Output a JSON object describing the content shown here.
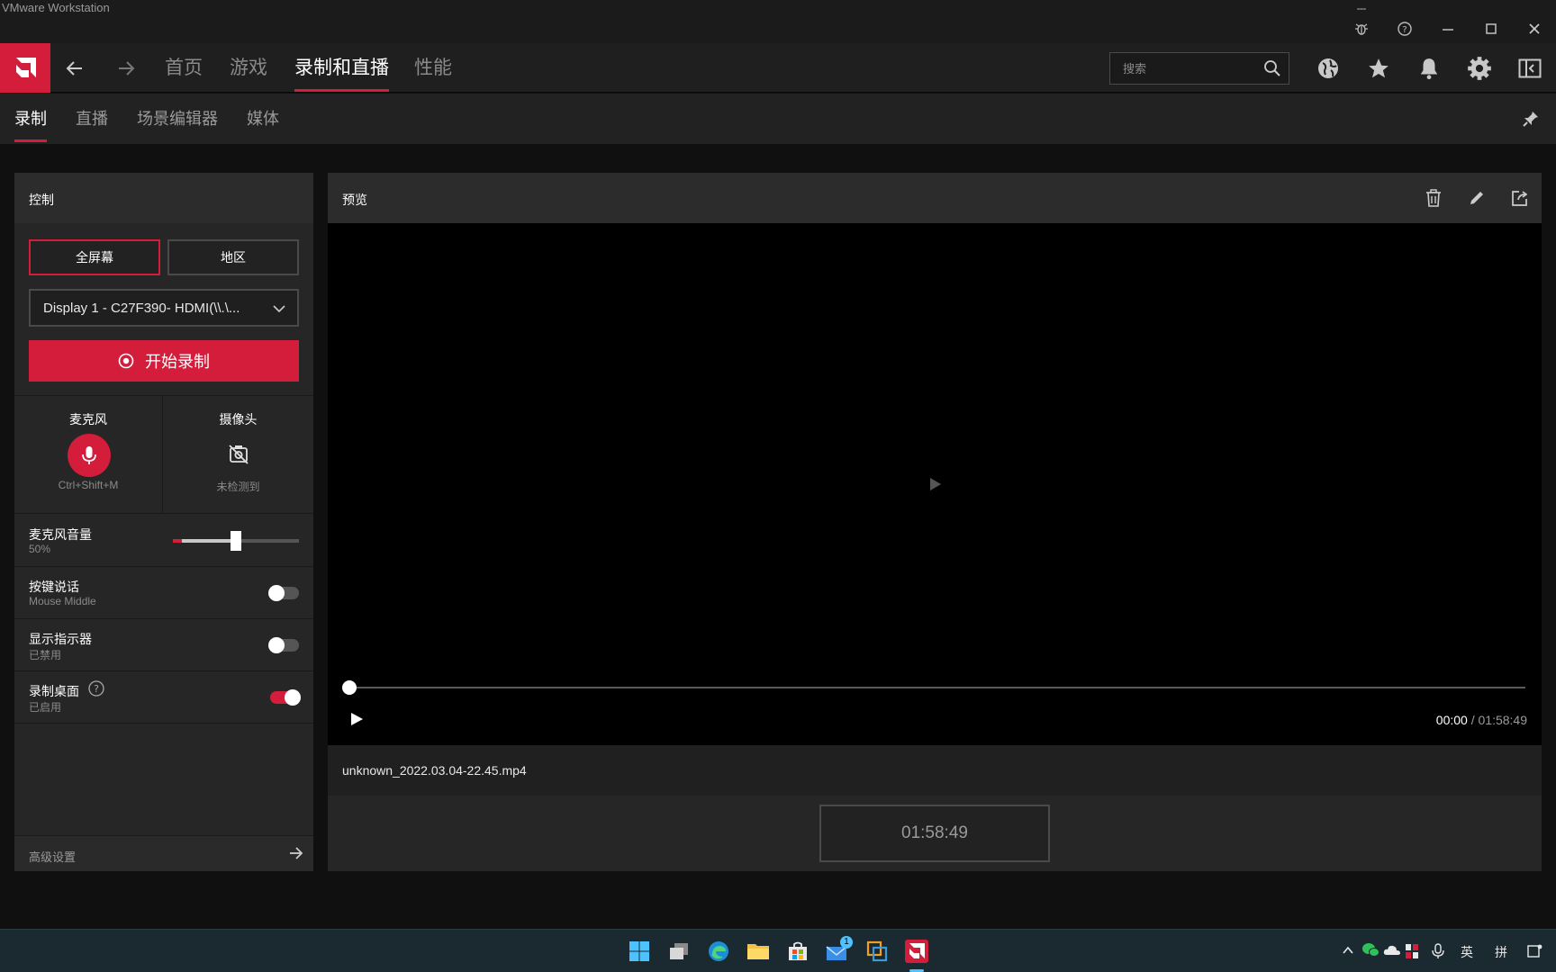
{
  "window": {
    "title": "VMware Workstation"
  },
  "header": {
    "tabs": [
      {
        "label": "首页"
      },
      {
        "label": "游戏"
      },
      {
        "label": "录制和直播"
      },
      {
        "label": "性能"
      }
    ],
    "active_tab": "录制和直播",
    "search_placeholder": "搜索"
  },
  "subnav": {
    "tabs": [
      {
        "label": "录制"
      },
      {
        "label": "直播"
      },
      {
        "label": "场景编辑器"
      },
      {
        "label": "媒体"
      }
    ],
    "active_tab": "录制"
  },
  "control": {
    "title": "控制",
    "mode_fullscreen": "全屏幕",
    "mode_region": "地区",
    "active_mode": "全屏幕",
    "display_value": "Display 1 - C27F390- HDMI(\\\\.\\...",
    "record_label": "开始录制",
    "mic": {
      "label": "麦克风",
      "shortcut": "Ctrl+Shift+M"
    },
    "camera": {
      "label": "摄像头",
      "status": "未检测到"
    },
    "mic_volume": {
      "label": "麦克风音量",
      "value_text": "50%",
      "value": 50
    },
    "push_to_talk": {
      "label": "按键说话",
      "sub": "Mouse Middle",
      "enabled": false
    },
    "show_indicator": {
      "label": "显示指示器",
      "sub": "已禁用",
      "enabled": false
    },
    "record_desktop": {
      "label": "录制桌面",
      "sub": "已启用",
      "enabled": true
    },
    "advanced": "高级设置"
  },
  "preview": {
    "title": "预览",
    "time_current": "00:00",
    "time_separator": " / ",
    "time_total": "01:58:49",
    "filename": "unknown_2022.03.04-22.45.mp4",
    "duration": "01:58:49"
  },
  "taskbar": {
    "mail_badge": "1",
    "lang1": "英",
    "lang2": "拼"
  },
  "colors": {
    "accent": "#d31d3a",
    "background": "#101010",
    "panel": "#262626"
  }
}
